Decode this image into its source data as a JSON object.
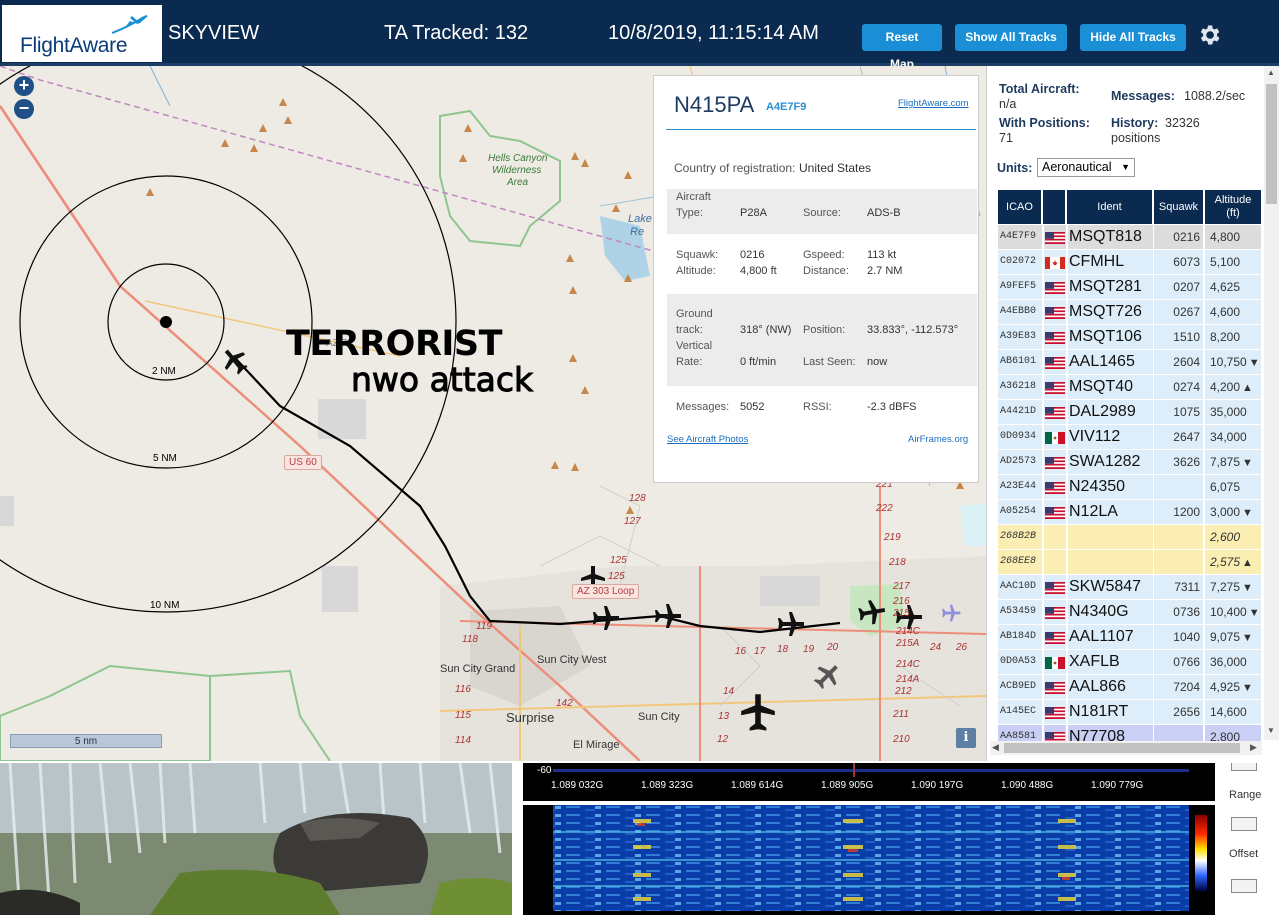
{
  "header": {
    "logo_text": "FlightAware",
    "app_name": "SKYVIEW",
    "ta_tracked": "TA Tracked: 132",
    "datetime": "10/8/2019, 11:15:14 AM",
    "buttons": {
      "reset": "Reset Map",
      "show": "Show All Tracks",
      "hide": "Hide All Tracks"
    }
  },
  "map": {
    "zoom_in": "+",
    "zoom_out": "−",
    "scale": "5 nm",
    "info": "i",
    "rings": [
      "2 NM",
      "5 NM",
      "10 NM"
    ],
    "overlay_line1": "TERRORIST",
    "overlay_line2": "nwo attack",
    "place_labels": {
      "hells_canyon": "Hells Canyon",
      "wilderness": "Wilderness",
      "area": "Area",
      "lake": "Lake",
      "re": "Re",
      "sun_city_grand": "Sun City Grand",
      "sun_city_west": "Sun City West",
      "surprise": "Surprise",
      "sun_city": "Sun City",
      "el_mirage": "El Mirage"
    },
    "road_labels": {
      "us60": "US 60",
      "az303": "AZ 303 Loop",
      "az74": "AZ 74"
    },
    "mile_markers": [
      "128",
      "127",
      "125",
      "125",
      "119",
      "118",
      "116",
      "115",
      "114",
      "142",
      "17",
      "16",
      "18",
      "19",
      "20",
      "14",
      "13",
      "12",
      "219",
      "218",
      "217",
      "216",
      "215",
      "214C",
      "215A",
      "24",
      "26",
      "214C",
      "214A",
      "212",
      "211",
      "210",
      "221",
      "222"
    ]
  },
  "popup": {
    "ident": "N415PA",
    "icao": "A4E7F9",
    "fa_link": "FlightAware.com",
    "country_label": "Country of registration:",
    "country_value": "United States",
    "aircraft_type_label1": "Aircraft",
    "aircraft_type_label2": "Type:",
    "aircraft_type_value": "P28A",
    "source_label": "Source:",
    "source_value": "ADS-B",
    "squawk_label": "Squawk:",
    "squawk_value": "0216",
    "gspeed_label": "Gspeed:",
    "gspeed_value": "113 kt",
    "altitude_label": "Altitude:",
    "altitude_value": "4,800 ft",
    "distance_label": "Distance:",
    "distance_value": "2.7 NM",
    "ground_label1": "Ground",
    "ground_label2": "track:",
    "ground_value": "318° (NW)",
    "position_label": "Position:",
    "position_value": "33.833°, -112.573°",
    "vertical_label1": "Vertical",
    "vertical_label2": "Rate:",
    "vertical_value": "0 ft/min",
    "last_seen_label": "Last Seen:",
    "last_seen_value": "now",
    "messages_label": "Messages:",
    "messages_value": "5052",
    "rssi_label": "RSSI:",
    "rssi_value": "-2.3 dBFS",
    "photos_link": "See Aircraft Photos",
    "airframes_link": "AirFrames.org"
  },
  "side": {
    "total_label": "Total Aircraft:",
    "total_value": "n/a",
    "messages_label": "Messages:",
    "messages_value": "1088.2/sec",
    "positions_label": "With Positions:",
    "positions_value": "71",
    "history_label": "History:",
    "history_value": "32326",
    "history_unit": "positions",
    "units_label": "Units:",
    "units_value": "Aeronautical",
    "columns": {
      "icao": "ICAO",
      "ident": "Ident",
      "squawk": "Squawk",
      "alt1": "Altitude",
      "alt2": "(ft)"
    },
    "rows": [
      {
        "icao": "A4E7F9",
        "flag": "us",
        "ident": "MSQT818",
        "squawk": "0216",
        "alt": "4,800",
        "trend": "",
        "style": "selected"
      },
      {
        "icao": "C02072",
        "flag": "ca",
        "ident": "CFMHL",
        "squawk": "6073",
        "alt": "5,100",
        "trend": "",
        "style": "light"
      },
      {
        "icao": "A9FEF5",
        "flag": "us",
        "ident": "MSQT281",
        "squawk": "0207",
        "alt": "4,625",
        "trend": "",
        "style": "light"
      },
      {
        "icao": "A4EBB0",
        "flag": "us",
        "ident": "MSQT726",
        "squawk": "0267",
        "alt": "4,600",
        "trend": "",
        "style": "light"
      },
      {
        "icao": "A39E83",
        "flag": "us",
        "ident": "MSQT106",
        "squawk": "1510",
        "alt": "8,200",
        "trend": "",
        "style": "light"
      },
      {
        "icao": "AB6101",
        "flag": "us",
        "ident": "AAL1465",
        "squawk": "2604",
        "alt": "10,750",
        "trend": "▼",
        "style": "light"
      },
      {
        "icao": "A36218",
        "flag": "us",
        "ident": "MSQT40",
        "squawk": "0274",
        "alt": "4,200",
        "trend": "▲",
        "style": "light"
      },
      {
        "icao": "A4421D",
        "flag": "us",
        "ident": "DAL2989",
        "squawk": "1075",
        "alt": "35,000",
        "trend": "",
        "style": "light"
      },
      {
        "icao": "0D0934",
        "flag": "mx",
        "ident": "VIV112",
        "squawk": "2647",
        "alt": "34,000",
        "trend": "",
        "style": "light"
      },
      {
        "icao": "AD2573",
        "flag": "us",
        "ident": "SWA1282",
        "squawk": "3626",
        "alt": "7,875",
        "trend": "▼",
        "style": "light"
      },
      {
        "icao": "A23E44",
        "flag": "us",
        "ident": "N24350",
        "squawk": "",
        "alt": "6,075",
        "trend": "",
        "style": "light"
      },
      {
        "icao": "A05254",
        "flag": "us",
        "ident": "N12LA",
        "squawk": "1200",
        "alt": "3,000",
        "trend": "▼",
        "style": "light"
      },
      {
        "icao": "268B2B",
        "flag": "",
        "ident": "",
        "squawk": "",
        "alt": "2,600",
        "trend": "",
        "style": "yellow"
      },
      {
        "icao": "268EE8",
        "flag": "",
        "ident": "",
        "squawk": "",
        "alt": "2,575",
        "trend": "▲",
        "style": "yellow"
      },
      {
        "icao": "AAC10D",
        "flag": "us",
        "ident": "SKW5847",
        "squawk": "7311",
        "alt": "7,275",
        "trend": "▼",
        "style": "light"
      },
      {
        "icao": "A53459",
        "flag": "us",
        "ident": "N4340G",
        "squawk": "0736",
        "alt": "10,400",
        "trend": "▼",
        "style": "light"
      },
      {
        "icao": "AB184D",
        "flag": "us",
        "ident": "AAL1107",
        "squawk": "1040",
        "alt": "9,075",
        "trend": "▼",
        "style": "light"
      },
      {
        "icao": "0D0A53",
        "flag": "mx",
        "ident": "XAFLB",
        "squawk": "0766",
        "alt": "36,000",
        "trend": "",
        "style": "light"
      },
      {
        "icao": "ACB9ED",
        "flag": "us",
        "ident": "AAL866",
        "squawk": "7204",
        "alt": "4,925",
        "trend": "▼",
        "style": "light"
      },
      {
        "icao": "A145EC",
        "flag": "us",
        "ident": "N181RT",
        "squawk": "2656",
        "alt": "14,600",
        "trend": "",
        "style": "light"
      },
      {
        "icao": "AA8581",
        "flag": "us",
        "ident": "N77708",
        "squawk": "",
        "alt": "2,800",
        "trend": "",
        "style": "purple"
      }
    ]
  },
  "spectrum": {
    "db": "-60",
    "freqs": [
      "1.089 032G",
      "1.089 323G",
      "1.089 614G",
      "1.089 905G",
      "1.090 197G",
      "1.090 488G",
      "1.090 779G"
    ],
    "range_label": "Range",
    "offset_label": "Offset"
  },
  "colors": {
    "header_bg": "#0b2a4f",
    "button_bg": "#1a8fd6",
    "row_light": "#ddeefa",
    "row_selected": "#dcdcdc",
    "row_yellow": "#fbeeb3",
    "row_purple": "#c9cff5"
  }
}
